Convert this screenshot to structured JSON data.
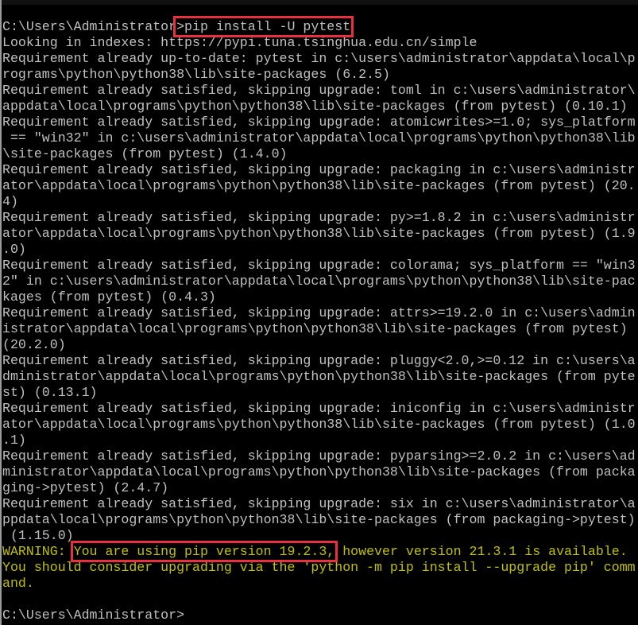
{
  "colors": {
    "text": "#c0c0c0",
    "warning": "#c0c000",
    "highlight_box": "#e8303f",
    "background": "#000000"
  },
  "console": {
    "lines": [
      {
        "parts": [
          {
            "text": "C:\\Users\\Administrator"
          },
          {
            "text": ">pip install -U pytest",
            "boxed": true
          }
        ]
      },
      {
        "parts": [
          {
            "text": "Looking in indexes: https://pypi.tuna.tsinghua.edu.cn/simple"
          }
        ]
      },
      {
        "parts": [
          {
            "text": "Requirement already up-to-date: pytest in c:\\users\\administrator\\appdata\\local\\p"
          }
        ]
      },
      {
        "parts": [
          {
            "text": "rograms\\python\\python38\\lib\\site-packages (6.2.5)"
          }
        ]
      },
      {
        "parts": [
          {
            "text": "Requirement already satisfied, skipping upgrade: toml in c:\\users\\administrator\\"
          }
        ]
      },
      {
        "parts": [
          {
            "text": "appdata\\local\\programs\\python\\python38\\lib\\site-packages (from pytest) (0.10.1)"
          }
        ]
      },
      {
        "parts": [
          {
            "text": "Requirement already satisfied, skipping upgrade: atomicwrites>=1.0; sys_platform"
          }
        ]
      },
      {
        "parts": [
          {
            "text": " == \"win32\" in c:\\users\\administrator\\appdata\\local\\programs\\python\\python38\\lib"
          }
        ]
      },
      {
        "parts": [
          {
            "text": "\\site-packages (from pytest) (1.4.0)"
          }
        ]
      },
      {
        "parts": [
          {
            "text": "Requirement already satisfied, skipping upgrade: packaging in c:\\users\\administr"
          }
        ]
      },
      {
        "parts": [
          {
            "text": "ator\\appdata\\local\\programs\\python\\python38\\lib\\site-packages (from pytest) (20."
          }
        ]
      },
      {
        "parts": [
          {
            "text": "4)"
          }
        ]
      },
      {
        "parts": [
          {
            "text": "Requirement already satisfied, skipping upgrade: py>=1.8.2 in c:\\users\\administr"
          }
        ]
      },
      {
        "parts": [
          {
            "text": "ator\\appdata\\local\\programs\\python\\python38\\lib\\site-packages (from pytest) (1.9"
          }
        ]
      },
      {
        "parts": [
          {
            "text": ".0)"
          }
        ]
      },
      {
        "parts": [
          {
            "text": "Requirement already satisfied, skipping upgrade: colorama; sys_platform == \"win3"
          }
        ]
      },
      {
        "parts": [
          {
            "text": "2\" in c:\\users\\administrator\\appdata\\local\\programs\\python\\python38\\lib\\site-pac"
          }
        ]
      },
      {
        "parts": [
          {
            "text": "kages (from pytest) (0.4.3)"
          }
        ]
      },
      {
        "parts": [
          {
            "text": "Requirement already satisfied, skipping upgrade: attrs>=19.2.0 in c:\\users\\admin"
          }
        ]
      },
      {
        "parts": [
          {
            "text": "istrator\\appdata\\local\\programs\\python\\python38\\lib\\site-packages (from pytest)"
          }
        ]
      },
      {
        "parts": [
          {
            "text": "(20.2.0)"
          }
        ]
      },
      {
        "parts": [
          {
            "text": "Requirement already satisfied, skipping upgrade: pluggy<2.0,>=0.12 in c:\\users\\a"
          }
        ]
      },
      {
        "parts": [
          {
            "text": "dministrator\\appdata\\local\\programs\\python\\python38\\lib\\site-packages (from pyte"
          }
        ]
      },
      {
        "parts": [
          {
            "text": "st) (0.13.1)"
          }
        ]
      },
      {
        "parts": [
          {
            "text": "Requirement already satisfied, skipping upgrade: iniconfig in c:\\users\\administr"
          }
        ]
      },
      {
        "parts": [
          {
            "text": "ator\\appdata\\local\\programs\\python\\python38\\lib\\site-packages (from pytest) (1.0"
          }
        ]
      },
      {
        "parts": [
          {
            "text": ".1)"
          }
        ]
      },
      {
        "parts": [
          {
            "text": "Requirement already satisfied, skipping upgrade: pyparsing>=2.0.2 in c:\\users\\ad"
          }
        ]
      },
      {
        "parts": [
          {
            "text": "ministrator\\appdata\\local\\programs\\python\\python38\\lib\\site-packages (from packa"
          }
        ]
      },
      {
        "parts": [
          {
            "text": "ging->pytest) (2.4.7)"
          }
        ]
      },
      {
        "parts": [
          {
            "text": "Requirement already satisfied, skipping upgrade: six in c:\\users\\administrator\\a"
          }
        ]
      },
      {
        "parts": [
          {
            "text": "ppdata\\local\\programs\\python\\python38\\lib\\site-packages (from packaging->pytest)"
          }
        ]
      },
      {
        "parts": [
          {
            "text": " (1.15.0)"
          }
        ]
      },
      {
        "warn": true,
        "parts": [
          {
            "text": "WARNING: "
          },
          {
            "text": "You are using pip version 19.2.3,",
            "boxed": true
          },
          {
            "text": " however version 21.3.1 is available."
          }
        ]
      },
      {
        "warn": true,
        "parts": [
          {
            "text": "You should consider upgrading via the 'python -m pip install --upgrade pip' comm"
          }
        ]
      },
      {
        "warn": true,
        "parts": [
          {
            "text": "and."
          }
        ]
      },
      {
        "parts": [
          {
            "text": ""
          }
        ]
      },
      {
        "parts": [
          {
            "text": "C:\\Users\\Administrator>"
          }
        ]
      }
    ]
  }
}
